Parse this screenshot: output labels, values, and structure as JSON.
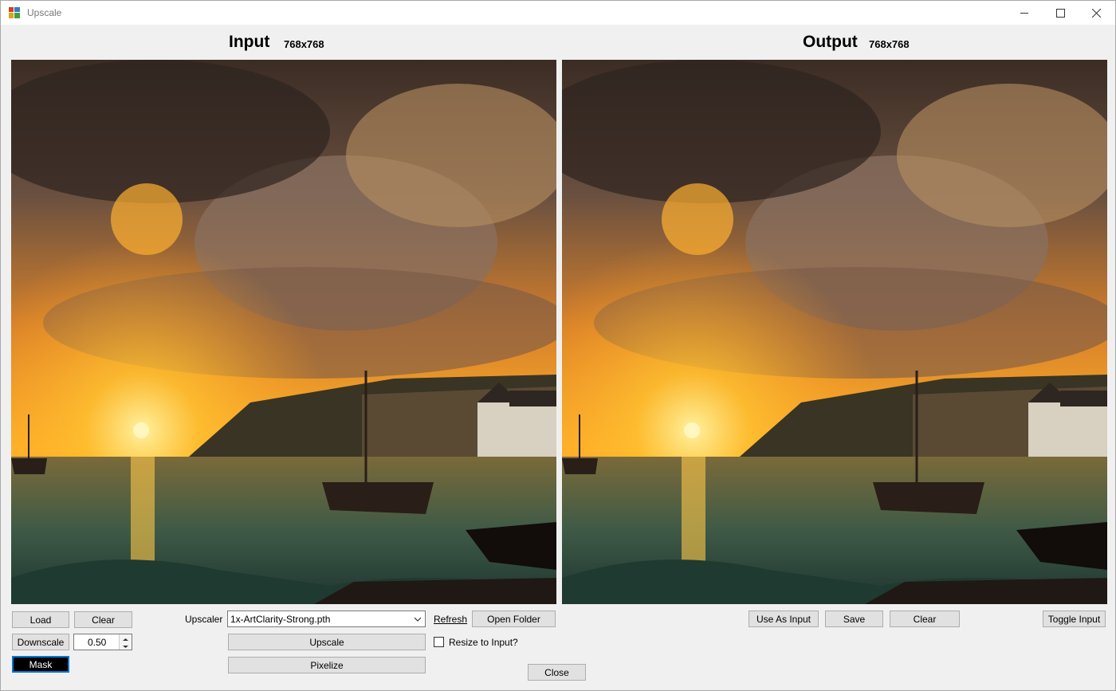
{
  "window": {
    "title": "Upscale",
    "icons": {
      "app": "app-icon",
      "minimize": "minimize-icon",
      "maximize": "maximize-icon",
      "close": "close-icon"
    }
  },
  "input": {
    "heading": "Input",
    "dimensions": "768x768",
    "buttons": {
      "load": "Load",
      "clear": "Clear",
      "downscale": "Downscale",
      "mask": "Mask"
    },
    "downscale_value": "0.50"
  },
  "upscaler": {
    "label": "Upscaler",
    "selected_model": "1x-ArtClarity-Strong.pth",
    "refresh_link": "Refresh",
    "open_folder": "Open Folder",
    "upscale_button": "Upscale",
    "pixelize_button": "Pixelize",
    "resize_to_input_label": "Resize to Input?",
    "resize_to_input_checked": false
  },
  "output": {
    "heading": "Output",
    "dimensions": "768x768",
    "buttons": {
      "use_as_input": "Use As Input",
      "save": "Save",
      "clear": "Clear",
      "toggle_input": "Toggle Input"
    }
  },
  "footer": {
    "close_button": "Close"
  },
  "colors": {
    "window_bg": "#f0f0f0",
    "button_bg": "#e1e1e1",
    "mask_bg": "#000000",
    "focus_border": "#0078d7"
  }
}
